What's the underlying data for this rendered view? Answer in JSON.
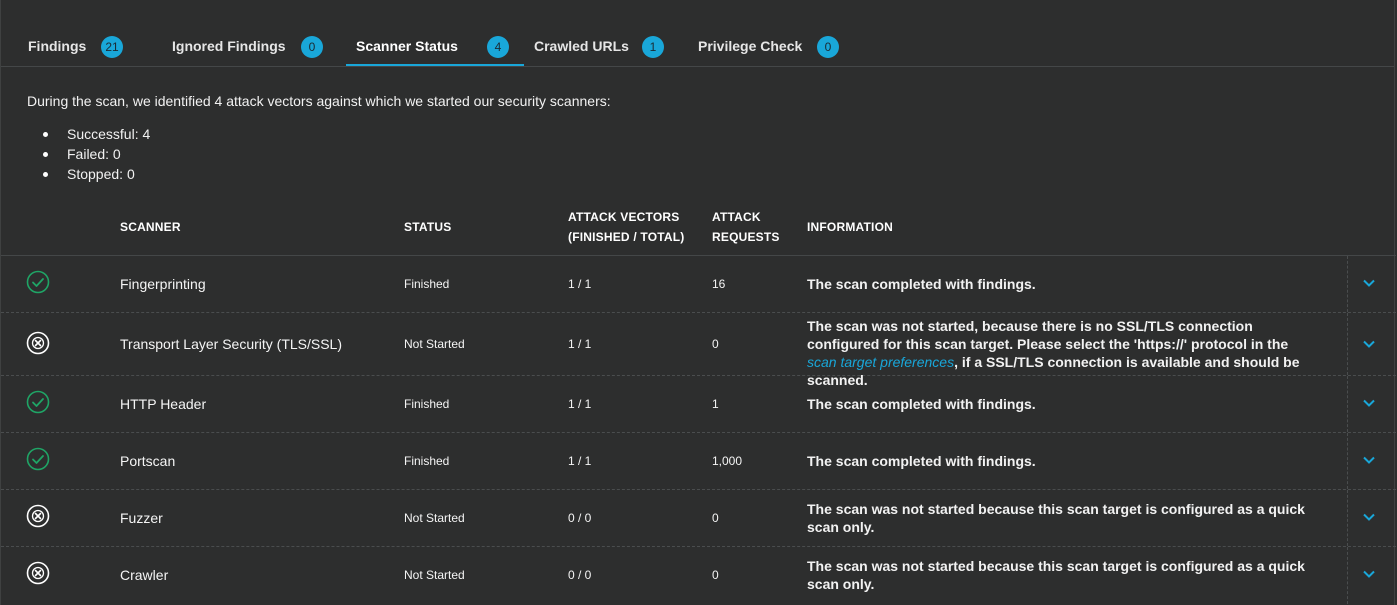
{
  "tabs": [
    {
      "label": "Findings",
      "count": "21"
    },
    {
      "label": "Ignored Findings",
      "count": "0"
    },
    {
      "label": "Scanner Status",
      "count": "4"
    },
    {
      "label": "Crawled URLs",
      "count": "1"
    },
    {
      "label": "Privilege Check",
      "count": "0"
    }
  ],
  "summary": {
    "intro": "During the scan, we identified 4 attack vectors against which we started our security scanners:",
    "items": [
      "Successful: 4",
      "Failed: 0",
      "Stopped: 0"
    ]
  },
  "table": {
    "headers": {
      "scanner": "SCANNER",
      "status": "STATUS",
      "vectors_line1": "ATTACK VECTORS",
      "vectors_line2": "(FINISHED / TOTAL)",
      "requests_line1": "ATTACK",
      "requests_line2": "REQUESTS",
      "information": "INFORMATION"
    },
    "rows": [
      {
        "result": "success",
        "name": "Fingerprinting",
        "status": "Finished",
        "vectors": "1 / 1",
        "requests": "16",
        "info": "The scan completed with findings."
      },
      {
        "result": "failed",
        "name": "Transport Layer Security (TLS/SSL)",
        "status": "Not Started",
        "vectors": "1 / 1",
        "requests": "0",
        "info_before": "The scan was not started, because there is no SSL/TLS connection configured for this scan target. Please select the 'https://' protocol in the ",
        "info_link": "scan target preferences",
        "info_after": ", if a SSL/TLS connection is available and should be scanned."
      },
      {
        "result": "success",
        "name": "HTTP Header",
        "status": "Finished",
        "vectors": "1 / 1",
        "requests": "1",
        "info": "The scan completed with findings."
      },
      {
        "result": "success",
        "name": "Portscan",
        "status": "Finished",
        "vectors": "1 / 1",
        "requests": "1,000",
        "info": "The scan completed with findings."
      },
      {
        "result": "failed",
        "name": "Fuzzer",
        "status": "Not Started",
        "vectors": "0 / 0",
        "requests": "0",
        "info": "The scan was not started because this scan target is configured as a quick scan only."
      },
      {
        "result": "failed",
        "name": "Crawler",
        "status": "Not Started",
        "vectors": "0 / 0",
        "requests": "0",
        "info": "The scan was not started because this scan target is configured as a quick scan only."
      }
    ]
  },
  "icons": {
    "success": "check-circle-icon",
    "failed": "x-circle-icon",
    "expand": "chevron-down-icon"
  },
  "colors": {
    "accent": "#19a7d9",
    "success": "#1fa566",
    "background": "#2d2e2e"
  }
}
